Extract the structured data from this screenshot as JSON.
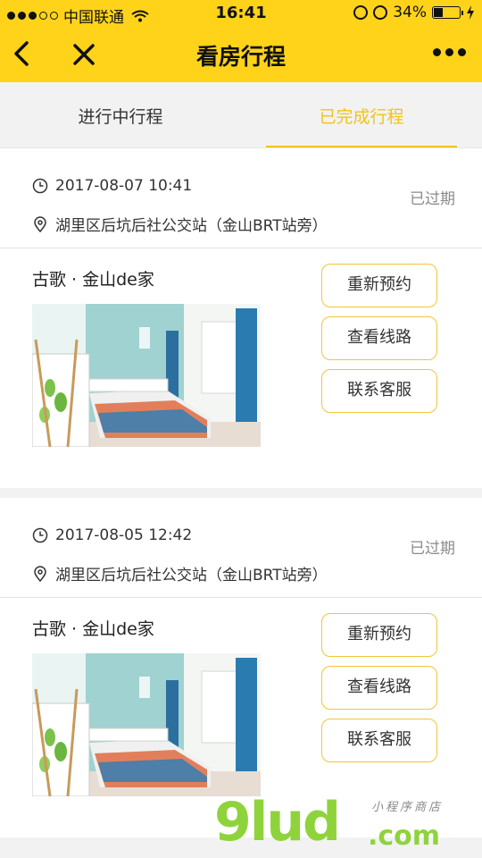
{
  "status_bar": {
    "carrier": "中国联通",
    "time": "16:41",
    "battery": "34%",
    "battery_level": 0.34
  },
  "nav": {
    "title": "看房行程"
  },
  "tabs": [
    {
      "label": "进行中行程",
      "active": false
    },
    {
      "label": "已完成行程",
      "active": true
    }
  ],
  "trips": [
    {
      "datetime": "2017-08-07 10:41",
      "address": "湖里区后坑后社公交站（金山BRT站旁）",
      "status": "已过期",
      "house_name": "古歌 · 金山de家",
      "buttons": [
        "重新预约",
        "查看线路",
        "联系客服"
      ]
    },
    {
      "datetime": "2017-08-05 12:42",
      "address": "湖里区后坑后社公交站（金山BRT站旁）",
      "status": "已过期",
      "house_name": "古歌 · 金山de家",
      "buttons": [
        "重新预约",
        "查看线路",
        "联系客服"
      ]
    }
  ],
  "watermark": {
    "brand": "9lud",
    "suffix": ".com",
    "tagline": "小程序商店"
  },
  "colors": {
    "accent": "#ffd31a",
    "active_tab": "#f0c419",
    "button_border": "#f2c53a",
    "watermark": "#8fd33c"
  }
}
